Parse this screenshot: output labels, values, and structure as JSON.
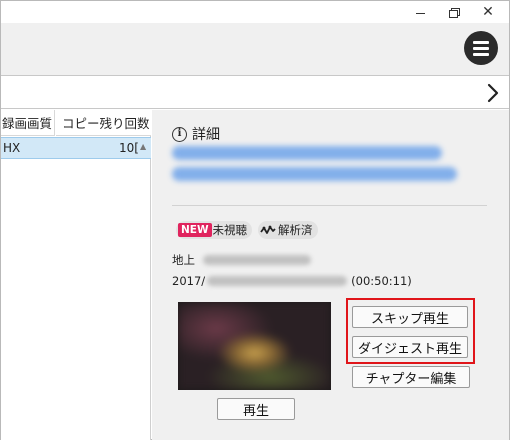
{
  "window_controls": {
    "close_glyph": "✕"
  },
  "list": {
    "columns": [
      "録画画質",
      "コピー残り回数"
    ],
    "rows": [
      {
        "quality": "HX",
        "copies_remaining": "10["
      }
    ]
  },
  "detail": {
    "heading": "詳細",
    "badges": {
      "new_label": "NEW",
      "unwatched_label": "未視聴",
      "analyzed_label": "解析済"
    },
    "channel_prefix": "地上",
    "date_prefix": "2017/",
    "duration": "(00:50:11)",
    "buttons": {
      "skip_play": "スキップ再生",
      "digest_play": "ダイジェスト再生",
      "chapter_edit": "チャプター編集",
      "play": "再生"
    }
  },
  "colors": {
    "highlight": "#e0151a",
    "selected_row": "#d2e8f7",
    "new_badge": "#e0245e"
  }
}
